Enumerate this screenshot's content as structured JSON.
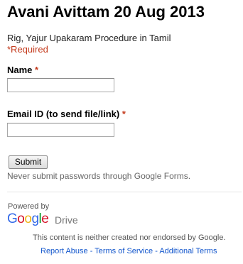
{
  "form": {
    "title": "Avani Avittam 20 Aug 2013",
    "description": "Rig, Yajur Upakaram Procedure in Tamil",
    "required_note": "*Required",
    "questions": [
      {
        "label": "Name",
        "required_marker": "*",
        "value": ""
      },
      {
        "label": "Email ID (to send file/link)",
        "required_marker": "*",
        "value": ""
      }
    ],
    "submit_label": "Submit",
    "password_warning": "Never submit passwords through Google Forms."
  },
  "footer": {
    "powered_by": "Powered by",
    "logo_letters": [
      "G",
      "o",
      "o",
      "g",
      "l",
      "e"
    ],
    "logo_colors": [
      "#3369e8",
      "#d50f25",
      "#eeb211",
      "#3369e8",
      "#009925",
      "#d50f25"
    ],
    "logo_product": "Drive",
    "disclaimer": "This content is neither created nor endorsed by Google.",
    "links": {
      "report_abuse": "Report Abuse",
      "sep1": " - ",
      "terms": "Terms of Service",
      "sep2": " - ",
      "additional": "Additional Terms"
    }
  }
}
